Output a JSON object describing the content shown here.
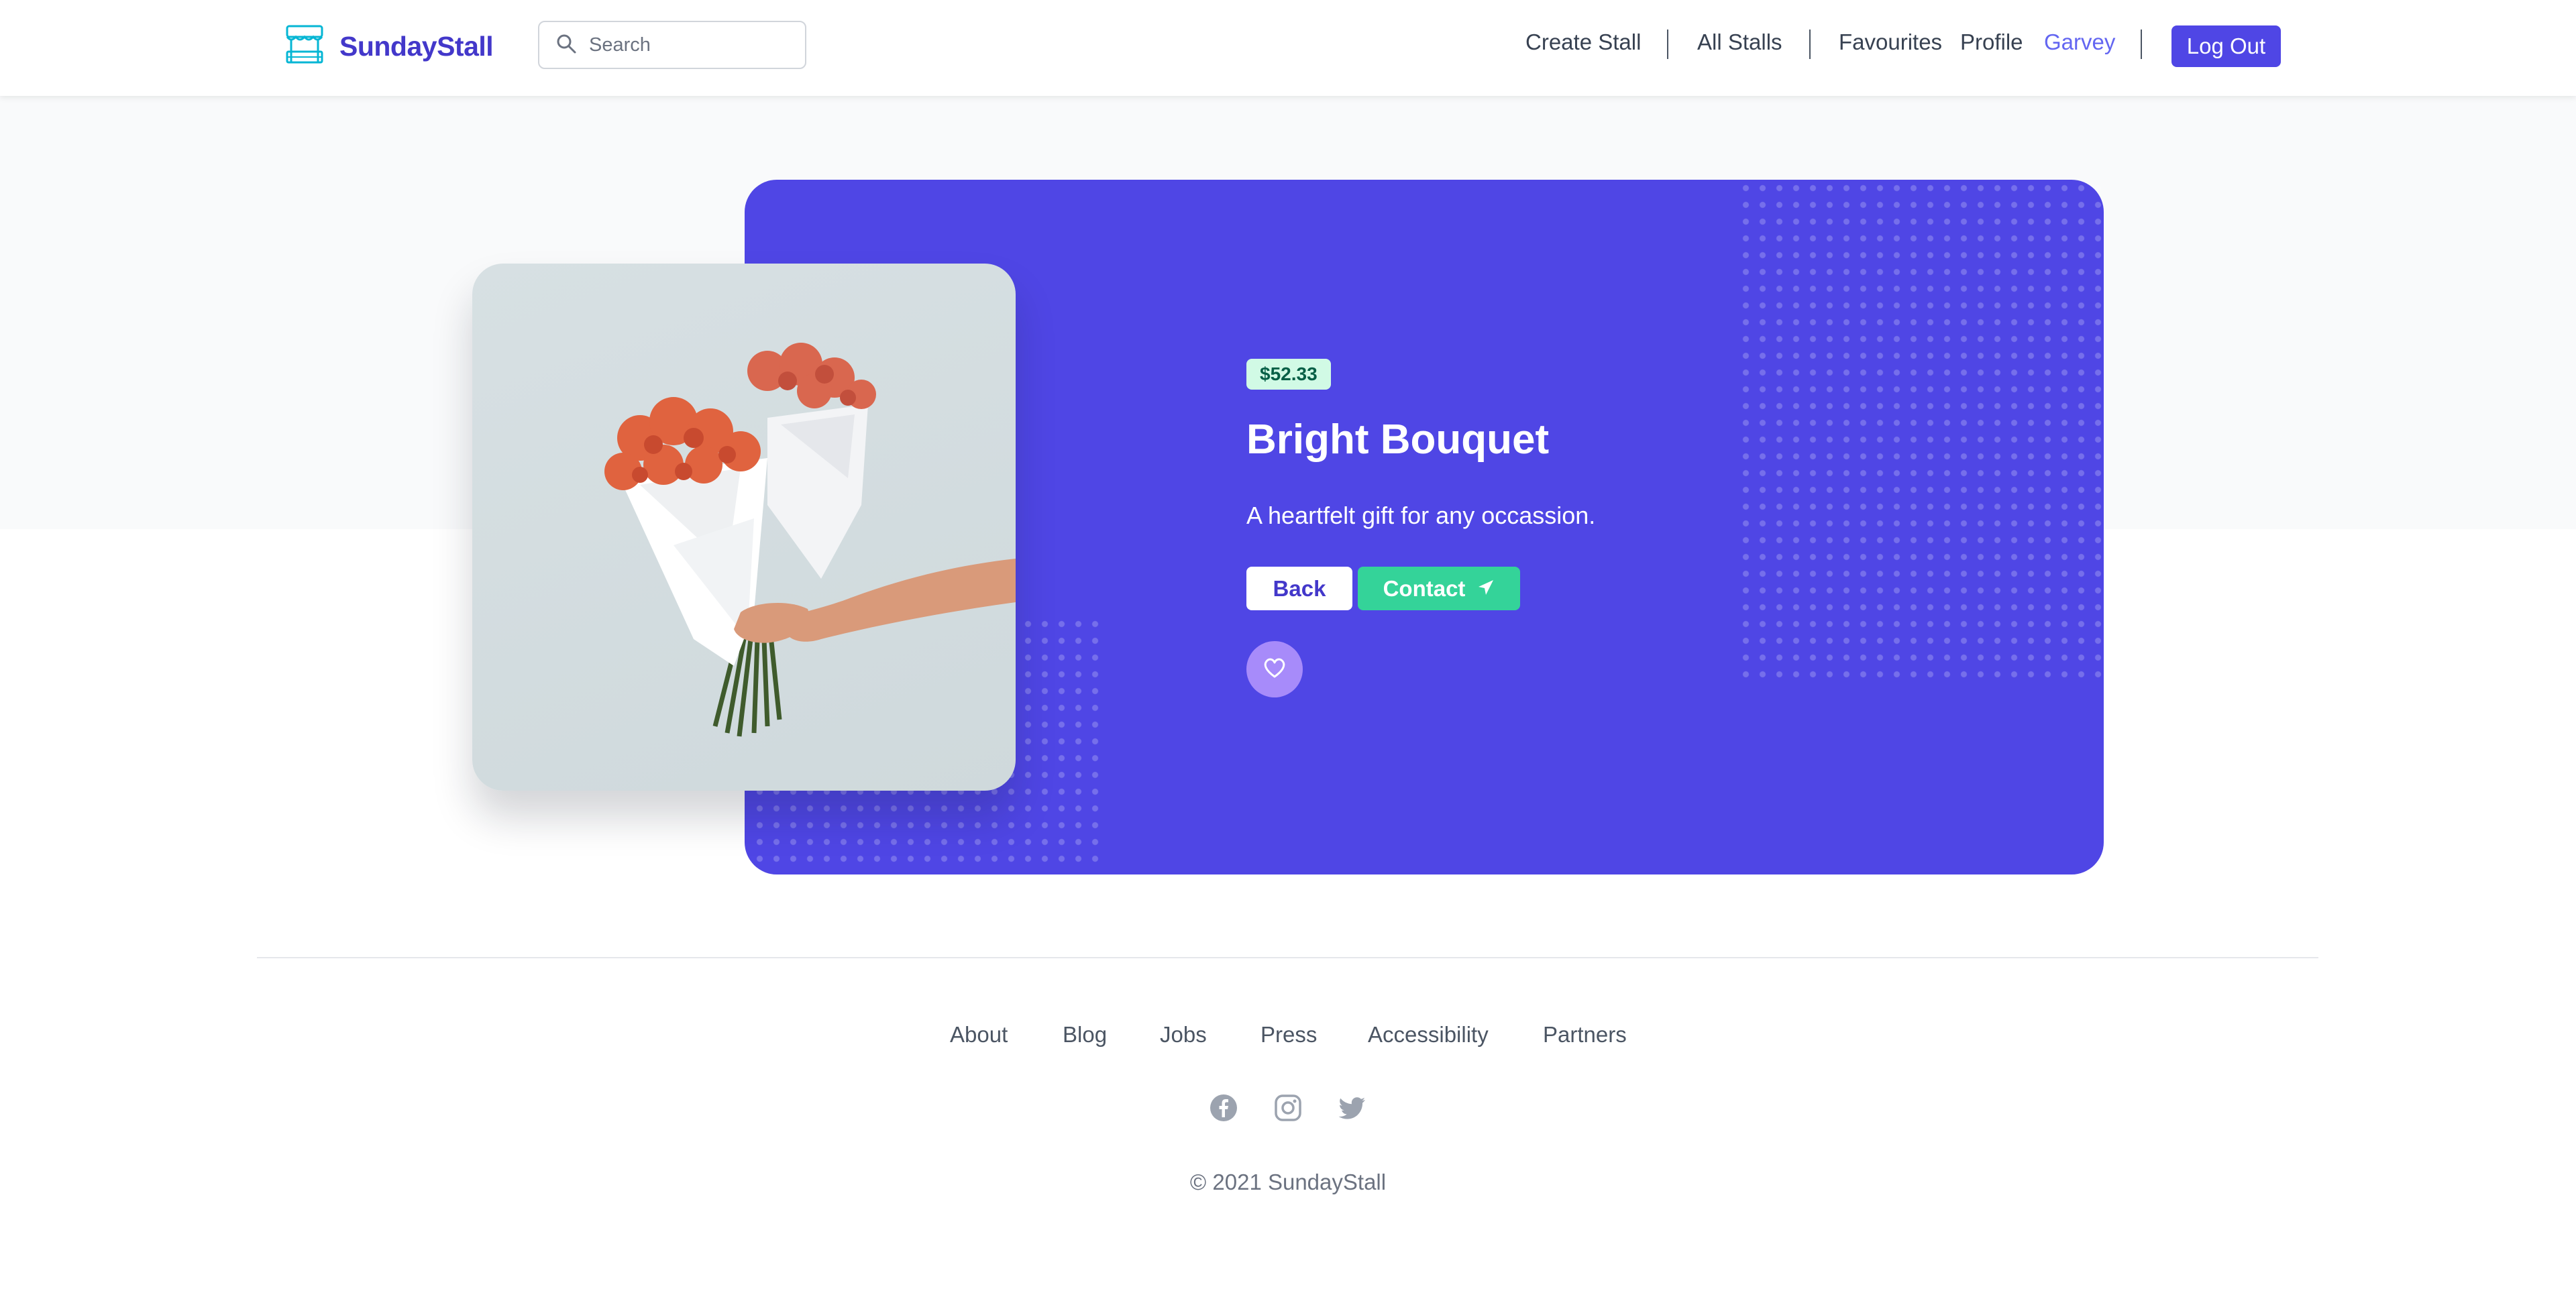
{
  "brand": {
    "name": "SundayStall",
    "icon": "stall-icon"
  },
  "search": {
    "placeholder": "Search",
    "value": ""
  },
  "nav": {
    "create_stall": "Create Stall",
    "all_stalls": "All Stalls",
    "favourites": "Favourites",
    "profile": "Profile",
    "username": "Garvey",
    "logout": "Log Out"
  },
  "product": {
    "price": "$52.33",
    "title": "Bright Bouquet",
    "description": "A heartfelt gift for any occassion.",
    "back_label": "Back",
    "contact_label": "Contact",
    "contact_icon": "send-icon",
    "favourite_icon": "heart-icon",
    "image_subject": "bouquet-of-flowers"
  },
  "footer": {
    "links": [
      "About",
      "Blog",
      "Jobs",
      "Press",
      "Accessibility",
      "Partners"
    ],
    "social": [
      "facebook-icon",
      "instagram-icon",
      "twitter-icon"
    ],
    "copyright": "© 2021 SundayStall"
  },
  "colors": {
    "brand": "#4338ca",
    "accent": "#4f46e5",
    "success": "#34d399",
    "price_bg": "#d1fae5",
    "favourite_bg": "#a78bfa",
    "hero_bg": "#f9fafb"
  }
}
